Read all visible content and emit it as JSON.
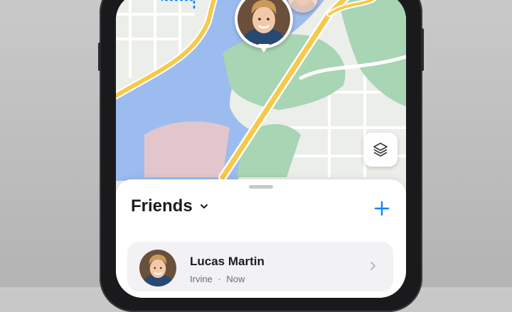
{
  "friends_sheet": {
    "title": "Friends",
    "title_icon": "chevron-down-icon",
    "add_icon": "plus-icon",
    "friends": [
      {
        "name": "Lucas Martin",
        "location": "Irvine",
        "separator": "·",
        "time": "Now"
      }
    ]
  },
  "map": {
    "layers_icon": "layers-icon"
  },
  "colors": {
    "accent": "#0a84ff",
    "water": "#9cbcef",
    "park": "#a8d5b3",
    "road": "#f6c94a",
    "sheet_bg": "#ffffff",
    "row_bg": "#f2f2f4"
  }
}
